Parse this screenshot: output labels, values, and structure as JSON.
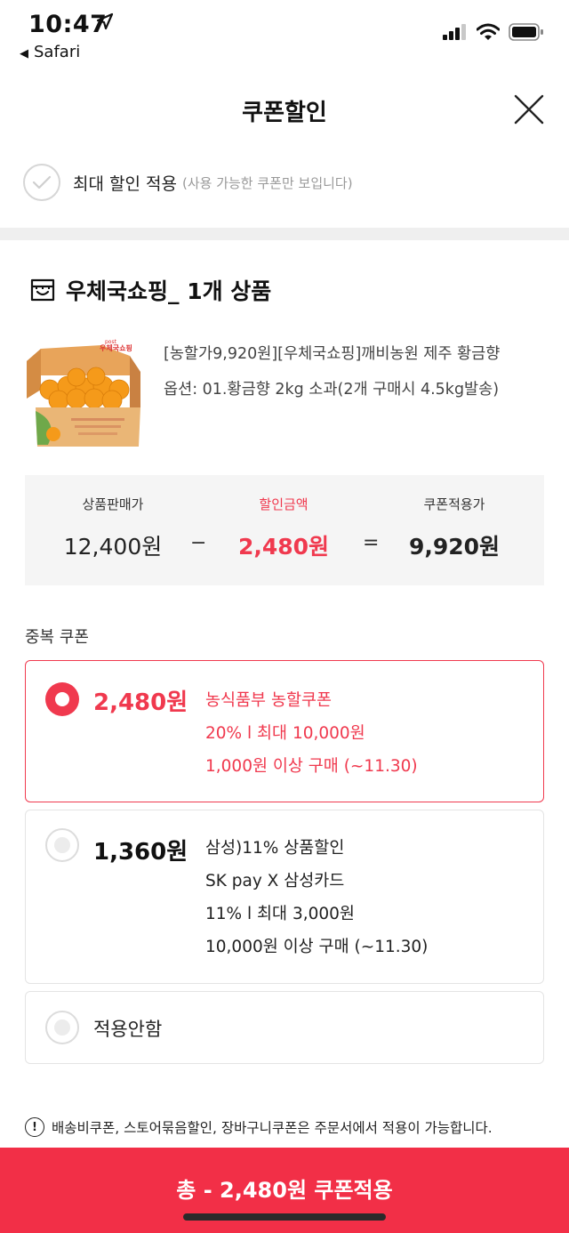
{
  "status_bar": {
    "time": "10:47",
    "back_app": "Safari"
  },
  "header": {
    "title": "쿠폰할인"
  },
  "max_discount": {
    "label": "최대 할인 적용",
    "sub": "(사용 가능한 쿠폰만 보입니다)"
  },
  "seller": {
    "name": "우체국쇼핑_ 1개 상품"
  },
  "product": {
    "title": "[농할가9,920원][우체국쇼핑]깨비농원 제주 황금향",
    "option": "옵션: 01.황금향 2kg 소과(2개 구매시 4.5kg발송)",
    "image_brand": "우체국쇼핑",
    "image_brand_small": "post"
  },
  "price_summary": {
    "sale_label": "상품판매가",
    "sale_value": "12,400원",
    "minus": "−",
    "discount_label": "할인금액",
    "discount_value": "2,480원",
    "equals": "=",
    "final_label": "쿠폰적용가",
    "final_value": "9,920원"
  },
  "coupons": {
    "section_label": "중복 쿠폰",
    "items": [
      {
        "amount": "2,480원",
        "lines": [
          "농식품부 농할쿠폰",
          "20% l 최대 10,000원",
          "1,000원 이상 구매 (~11.30)"
        ],
        "selected": true
      },
      {
        "amount": "1,360원",
        "lines": [
          "삼성)11% 상품할인",
          "SK pay X 삼성카드",
          "11% l 최대 3,000원",
          "10,000원 이상 구매 (~11.30)"
        ],
        "selected": false
      }
    ],
    "none_label": "적용안함"
  },
  "notice": {
    "icon": "!",
    "text": "배송비쿠폰, 스토어묶음할인, 장바구니쿠폰은 주문서에서 적용이 가능합니다."
  },
  "bottom": {
    "label": "총 - 2,480원 쿠폰적용"
  },
  "colors": {
    "accent": "#f0394e",
    "bottom_bar": "#f22f47"
  }
}
